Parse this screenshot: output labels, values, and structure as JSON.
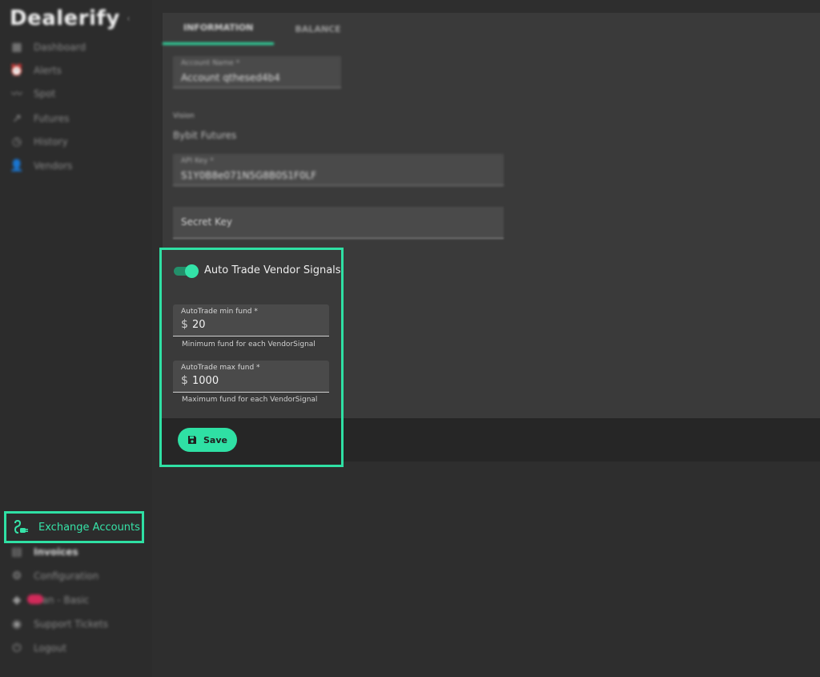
{
  "brand": {
    "name": "Dealerify",
    "collapse_glyph": "‹"
  },
  "sidebar": {
    "top_items": [
      {
        "label": "Dashboard",
        "icon": "dashboard-icon"
      },
      {
        "label": "Alerts",
        "icon": "alarm-icon"
      },
      {
        "label": "Spot",
        "icon": "trend-icon"
      },
      {
        "label": "Futures",
        "icon": "futures-icon"
      },
      {
        "label": "History",
        "icon": "history-icon"
      },
      {
        "label": "Vendors",
        "icon": "vendors-icon"
      }
    ],
    "active_item": {
      "label": "Exchange Accounts",
      "icon": "plug-icon"
    },
    "bottom_items": [
      {
        "label": "Invoices",
        "icon": "invoice-icon"
      },
      {
        "label": "Configuration",
        "icon": "gear-icon"
      },
      {
        "label": "Plan - Basic",
        "icon": "plan-icon"
      },
      {
        "label": "Support Tickets",
        "icon": "support-icon"
      },
      {
        "label": "Logout",
        "icon": "logout-icon"
      }
    ]
  },
  "tabs": [
    {
      "label": "INFORMATION"
    },
    {
      "label": "BALANCE"
    }
  ],
  "form": {
    "account_name": {
      "label": "Account Name *",
      "value": "Account qthesed4b4"
    },
    "exchange": {
      "label": "Vision",
      "value": "Bybit Futures"
    },
    "api_key": {
      "label": "API Key *",
      "value": "S1Y0B8e071N5G8B0S1F0LF"
    },
    "secret_key": {
      "placeholder": "Secret Key"
    }
  },
  "auto_trade": {
    "toggle_label": "Auto Trade Vendor Signals",
    "toggle_on": true,
    "min_fund": {
      "label": "AutoTrade min fund *",
      "currency": "$",
      "value": "20",
      "helper": "Minimum fund for each VendorSignal"
    },
    "max_fund": {
      "label": "AutoTrade max fund *",
      "currency": "$",
      "value": "1000",
      "helper": "Maximum fund for each VendorSignal"
    },
    "save_label": "Save"
  },
  "colors": {
    "accent": "#2fe0a4",
    "background": "#2e2e2e",
    "panel": "#3a3a3a",
    "field": "#4a4a4a",
    "footer": "#262626"
  }
}
